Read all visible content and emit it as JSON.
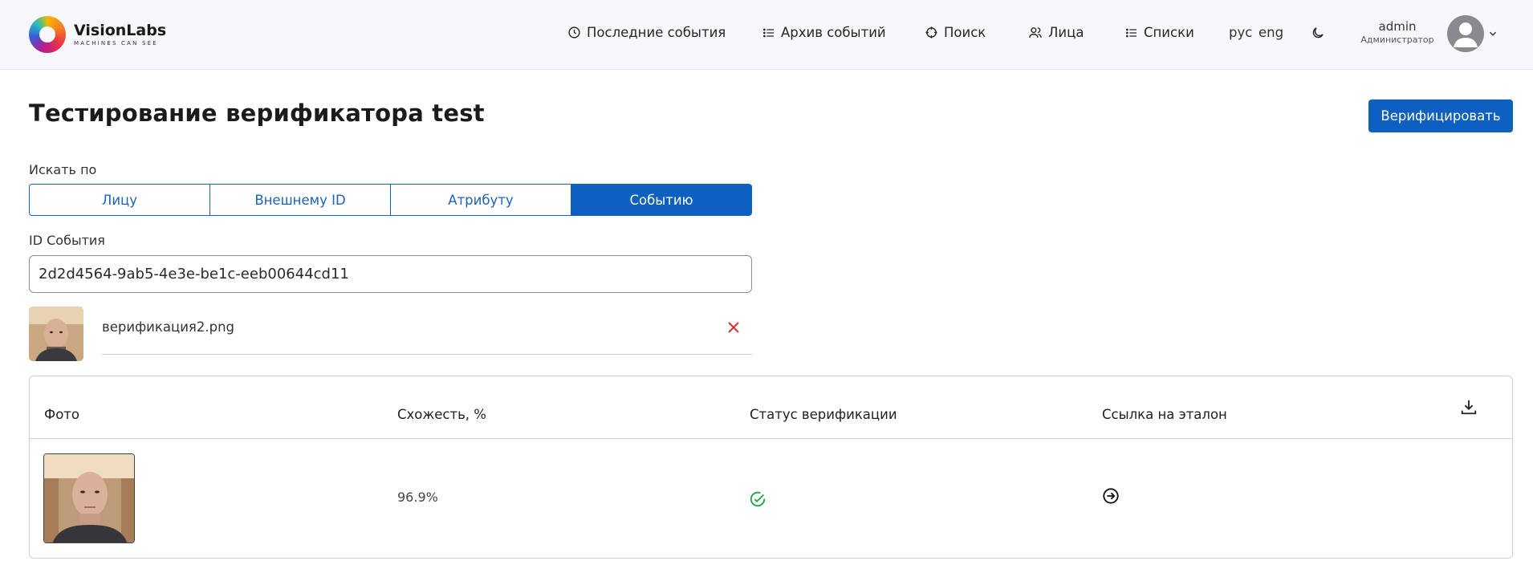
{
  "brand": {
    "name": "VisionLabs",
    "tagline": "MACHINES CAN SEE"
  },
  "nav": {
    "items": [
      {
        "label": "Последние события",
        "icon": "clock-icon"
      },
      {
        "label": "Архив событий",
        "icon": "list-icon"
      },
      {
        "label": "Поиск",
        "icon": "target-icon"
      },
      {
        "label": "Лица",
        "icon": "users-icon"
      },
      {
        "label": "Списки",
        "icon": "list-icon"
      }
    ],
    "lang_ru": "рус",
    "lang_en": "eng",
    "theme_icon": "moon-icon"
  },
  "user": {
    "name": "admin",
    "role": "Администратор"
  },
  "page": {
    "title": "Тестирование верификатора test",
    "verify_button": "Верифицировать"
  },
  "search": {
    "label": "Искать по",
    "options": [
      "Лицу",
      "Внешнему ID",
      "Атрибуту",
      "Событию"
    ],
    "active_option": "Событию"
  },
  "event_id": {
    "label": "ID События",
    "value": "2d2d4564-9ab5-4e3e-be1c-eeb00644cd11"
  },
  "file": {
    "name": "верификация2.png"
  },
  "table": {
    "headers": [
      "Фото",
      "Схожесть, %",
      "Статус верификации",
      "Ссылка на эталон"
    ],
    "rows": [
      {
        "similarity": "96.9%",
        "status": "verified",
        "status_icon": "check-circle-icon",
        "link_icon": "arrow-right-circle-icon"
      }
    ]
  },
  "colors": {
    "primary": "#0d5fc0",
    "success": "#1aa34a",
    "danger": "#d93030",
    "header_bg": "#f8f7fb"
  }
}
